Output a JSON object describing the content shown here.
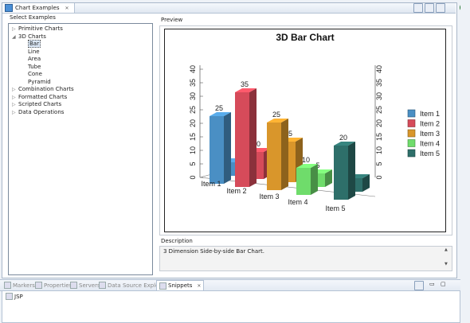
{
  "view": {
    "title": "Chart Examples"
  },
  "select_examples": {
    "label": "Select Examples"
  },
  "tree": {
    "items": [
      {
        "label": "Primitive Charts",
        "expanded": false
      },
      {
        "label": "3D Charts",
        "expanded": true,
        "children": [
          "Bar",
          "Line",
          "Area",
          "Tube",
          "Cone",
          "Pyramid"
        ]
      },
      {
        "label": "Combination Charts",
        "expanded": false
      },
      {
        "label": "Formatted Charts",
        "expanded": false
      },
      {
        "label": "Scripted Charts",
        "expanded": false
      },
      {
        "label": "Data Operations",
        "expanded": false
      }
    ],
    "selected": "Bar"
  },
  "preview": {
    "label": "Preview"
  },
  "description": {
    "label": "Description",
    "text": "3 Dimension Side-by-side Bar Chart."
  },
  "bottom_tabs": [
    "Markers",
    "Properties",
    "Servers",
    "Data Source Explorer",
    "Snippets"
  ],
  "bottom_active": "Snippets",
  "snippets_item": "JSP",
  "chart_data": {
    "type": "bar",
    "title": "3D Bar Chart",
    "categories": [
      "Item 1",
      "Item 2",
      "Item 3",
      "Item 4",
      "Item 5"
    ],
    "series": [
      {
        "values": [
          25,
          35,
          25,
          10,
          20
        ]
      },
      {
        "values": [
          5,
          10,
          15,
          5,
          5
        ]
      }
    ],
    "data_labels": [
      [
        "25",
        "35",
        "25",
        "10",
        "20"
      ],
      [
        "",
        "10",
        "15",
        "5",
        ""
      ]
    ],
    "ylim": [
      0,
      40
    ],
    "yticks": [
      "0",
      "5",
      "10",
      "15",
      "20",
      "25",
      "30",
      "35",
      "40"
    ],
    "legend": {
      "position": "right",
      "entries": [
        "Item 1",
        "Item 2",
        "Item 3",
        "Item 4",
        "Item 5"
      ],
      "colors": [
        "#4a8fc4",
        "#d64b5a",
        "#d9962b",
        "#6fdc6b",
        "#2e6f6a"
      ]
    },
    "bar_colors": [
      "#4a8fc4",
      "#d64b5a",
      "#d9962b",
      "#6fdc6b",
      "#2e6f6a"
    ]
  }
}
